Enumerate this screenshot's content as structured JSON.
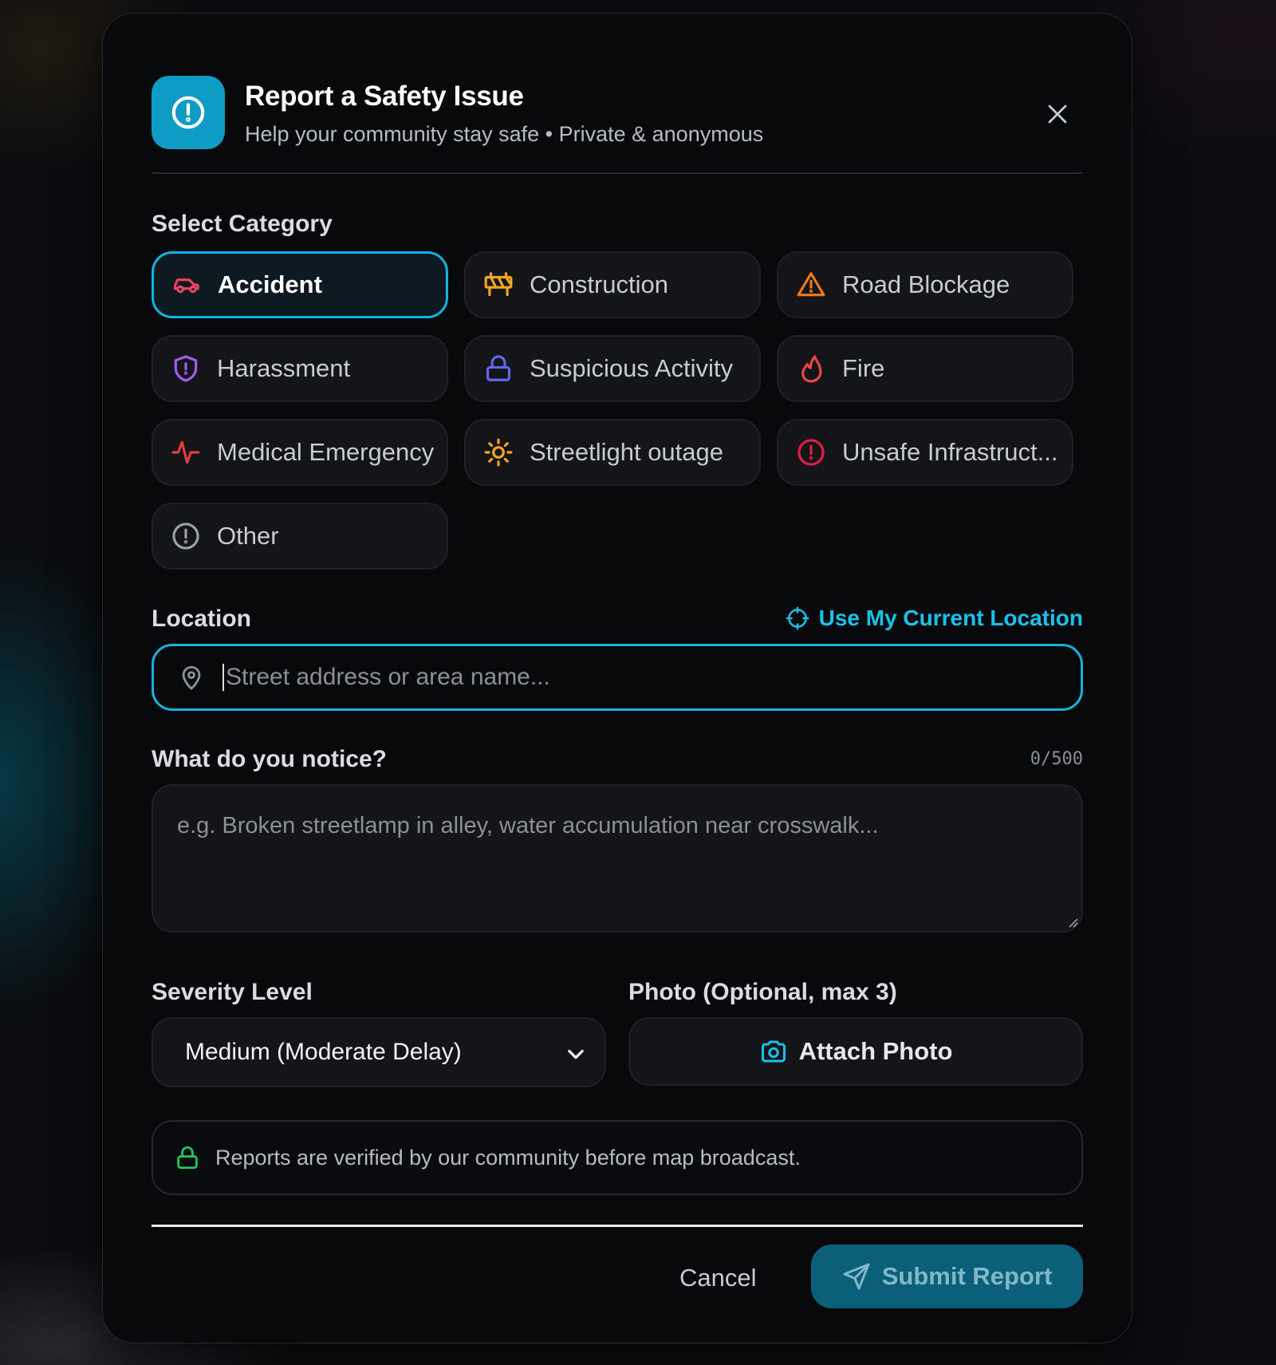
{
  "header": {
    "title": "Report a Safety Issue",
    "subtitle": "Help your community stay safe • Private & anonymous"
  },
  "category": {
    "label": "Select Category",
    "selected": "Accident",
    "items": [
      {
        "label": "Accident",
        "icon": "car-icon",
        "color": "#f0445c"
      },
      {
        "label": "Construction",
        "icon": "construction-barrier-icon",
        "color": "#f5a623"
      },
      {
        "label": "Road Blockage",
        "icon": "warning-triangle-icon",
        "color": "#f27a1a"
      },
      {
        "label": "Harassment",
        "icon": "shield-alert-icon",
        "color": "#a55cf2"
      },
      {
        "label": "Suspicious Activity",
        "icon": "lock-icon",
        "color": "#6466f1"
      },
      {
        "label": "Fire",
        "icon": "flame-icon",
        "color": "#ef4444"
      },
      {
        "label": "Medical Emergency",
        "icon": "pulse-icon",
        "color": "#e53b3b"
      },
      {
        "label": "Streetlight outage",
        "icon": "sun-icon",
        "color": "#f5a623"
      },
      {
        "label": "Unsafe Infrastruct...",
        "icon": "alert-circle-icon",
        "color": "#e11d48"
      },
      {
        "label": "Other",
        "icon": "info-circle-icon",
        "color": "#9aa1ab"
      }
    ]
  },
  "location": {
    "label": "Location",
    "use_current": "Use My Current Location",
    "placeholder": "Street address or area name..."
  },
  "notice": {
    "label": "What do you notice?",
    "counter": "0/500",
    "placeholder": "e.g. Broken streetlamp in alley, water accumulation near crosswalk..."
  },
  "severity": {
    "label": "Severity Level",
    "value": "Medium (Moderate Delay)"
  },
  "photo": {
    "label": "Photo (Optional, max 3)",
    "button": "Attach Photo"
  },
  "verify_notice": "Reports are verified by our community before map broadcast.",
  "footer": {
    "cancel": "Cancel",
    "submit": "Submit Report"
  },
  "colors": {
    "accent": "#14b4e0",
    "submit_bg": "#0c5f78",
    "verify_green": "#22c55e"
  }
}
